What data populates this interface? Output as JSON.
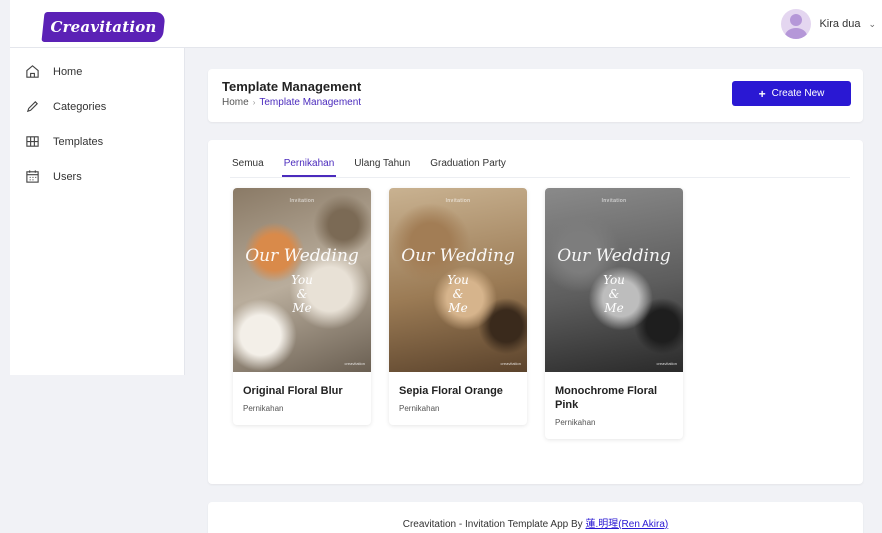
{
  "brand": {
    "logo_text": "Creavitation"
  },
  "user": {
    "name": "Kira dua"
  },
  "sidebar": {
    "items": [
      {
        "label": "Home",
        "icon": "home-icon"
      },
      {
        "label": "Categories",
        "icon": "pencil-icon"
      },
      {
        "label": "Templates",
        "icon": "grid-icon"
      },
      {
        "label": "Users",
        "icon": "calendar-icon"
      }
    ]
  },
  "header": {
    "title": "Template Management",
    "breadcrumb": {
      "home": "Home",
      "current": "Template Management"
    },
    "create_label": "Create New"
  },
  "tabs": {
    "items": [
      {
        "label": "Semua"
      },
      {
        "label": "Pernikahan"
      },
      {
        "label": "Ulang Tahun"
      },
      {
        "label": "Graduation Party"
      }
    ],
    "active": "Pernikahan"
  },
  "templates": [
    {
      "name": "Original Floral Blur",
      "category": "Pernikahan",
      "thumb": {
        "top": "Invitation",
        "title": "Our Wedding",
        "line1": "You",
        "amp": "&",
        "line2": "Me",
        "brand": "creavitation"
      }
    },
    {
      "name": "Sepia Floral Orange",
      "category": "Pernikahan",
      "thumb": {
        "top": "Invitation",
        "title": "Our Wedding",
        "line1": "You",
        "amp": "&",
        "line2": "Me",
        "brand": "creavitation"
      }
    },
    {
      "name": "Monochrome Floral Pink",
      "category": "Pernikahan",
      "thumb": {
        "top": "Invitation",
        "title": "Our Wedding",
        "line1": "You",
        "amp": "&",
        "line2": "Me",
        "brand": "creavitation"
      }
    }
  ],
  "footer": {
    "text": "Creavitation - Invitation Template App By ",
    "link": "蓮.明瑆(Ren Akira)"
  },
  "colors": {
    "accent": "#4b2bbd",
    "button": "#2a18d3",
    "logo_bg": "#5b21b6"
  }
}
